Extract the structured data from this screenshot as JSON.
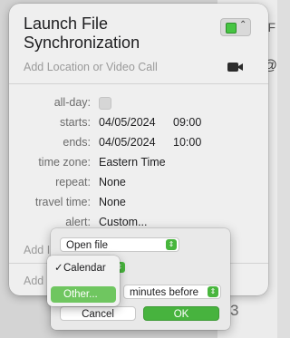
{
  "background": {
    "side_letter": "F",
    "side_letter2": "@",
    "corner_number": "3"
  },
  "event": {
    "title": "Launch File Synchronization",
    "location_placeholder": "Add Location or Video Call",
    "calendar_color": "#46c442",
    "video_icon": "video-camera-icon"
  },
  "details": {
    "all_day_label": "all-day:",
    "all_day_checked": false,
    "starts_label": "starts:",
    "starts_date": "04/05/2024",
    "starts_time": "09:00",
    "ends_label": "ends:",
    "ends_date": "04/05/2024",
    "ends_time": "10:00",
    "timezone_label": "time zone:",
    "timezone_value": "Eastern Time",
    "repeat_label": "repeat:",
    "repeat_value": "None",
    "travel_label": "travel time:",
    "travel_value": "None",
    "alert_label": "alert:",
    "alert_value": "Custom..."
  },
  "footer": {
    "add_invitees": "Add I",
    "add_notes": "Add"
  },
  "alert_panel": {
    "action_select": "Open file",
    "units_select": "minutes before",
    "cancel_label": "Cancel",
    "ok_label": "OK",
    "accent_color": "#47b33e"
  },
  "menu": {
    "items": [
      {
        "label": "Calendar",
        "checked": true
      },
      {
        "label": "Other...",
        "selected": true
      }
    ]
  }
}
